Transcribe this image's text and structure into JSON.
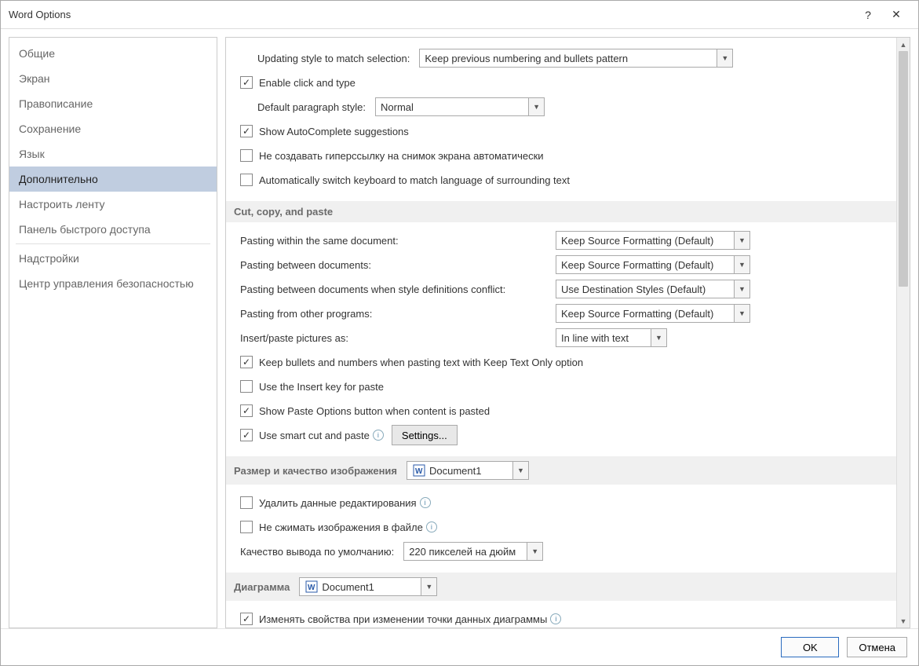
{
  "title": "Word Options",
  "sidebar": {
    "items": [
      {
        "label": "Общие",
        "sel": false
      },
      {
        "label": "Экран",
        "sel": false
      },
      {
        "label": "Правописание",
        "sel": false
      },
      {
        "label": "Сохранение",
        "sel": false
      },
      {
        "label": "Язык",
        "sel": false
      },
      {
        "label": "Дополнительно",
        "sel": true
      },
      {
        "label": "Настроить ленту",
        "sel": false
      },
      {
        "label": "Панель быстрого доступа",
        "sel": false
      },
      {
        "label": "Надстройки",
        "sel": false
      },
      {
        "label": "Центр управления безопасностью",
        "sel": false
      }
    ]
  },
  "opts": {
    "update_style_label": "Updating style to match selection:",
    "update_style_value": "Keep previous numbering and bullets pattern",
    "enable_click_type": "Enable click and type",
    "default_para_label": "Default paragraph style:",
    "default_para_value": "Normal",
    "show_autocomplete": "Show AutoComplete suggestions",
    "no_hyperlink": "Не создавать гиперссылку на снимок экрана автоматически",
    "auto_switch_kb": "Automatically switch keyboard to match language of surrounding text"
  },
  "cut": {
    "header": "Cut, copy, and paste",
    "paste_same_label": "Pasting within the same document:",
    "paste_same_value": "Keep Source Formatting (Default)",
    "paste_between_label": "Pasting between documents:",
    "paste_between_value": "Keep Source Formatting (Default)",
    "paste_conflict_label": "Pasting between documents when style definitions conflict:",
    "paste_conflict_value": "Use Destination Styles (Default)",
    "paste_other_label": "Pasting from other programs:",
    "paste_other_value": "Keep Source Formatting (Default)",
    "insert_pic_label": "Insert/paste pictures as:",
    "insert_pic_value": "In line with text",
    "keep_bullets": "Keep bullets and numbers when pasting text with Keep Text Only option",
    "use_insert": "Use the Insert key for paste",
    "show_paste_opts": "Show Paste Options button when content is pasted",
    "smart_cut": "Use smart cut and paste",
    "settings_btn": "Settings..."
  },
  "imgq": {
    "header": "Размер и качество изображения",
    "doc": "Document1",
    "delete_edit": "Удалить данные редактирования",
    "no_compress": "Не сжимать изображения в файле",
    "quality_label": "Качество вывода по умолчанию:",
    "quality_value": "220 пикселей на дюйм"
  },
  "chart": {
    "header": "Диаграмма",
    "doc": "Document1",
    "change_props": "Изменять свойства при изменении точки данных диаграммы"
  },
  "footer": {
    "ok": "OK",
    "cancel": "Отмена"
  }
}
